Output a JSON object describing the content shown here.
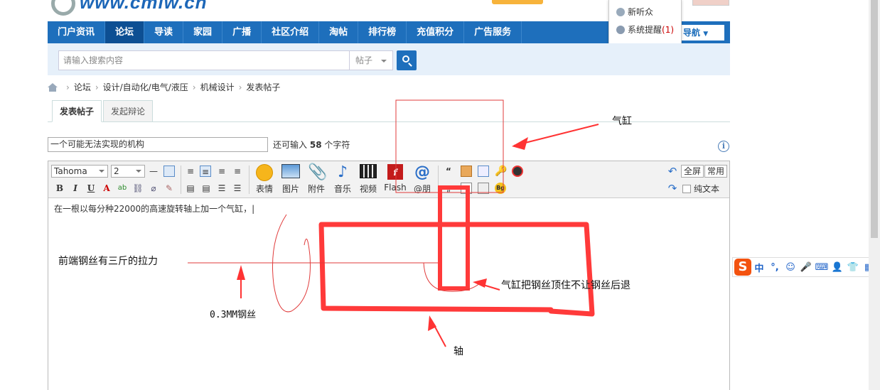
{
  "header": {
    "logo_text": "www.cmiw.cn"
  },
  "popup": {
    "items": [
      {
        "label": "新听众"
      },
      {
        "label": "系统提醒",
        "count": "(1)"
      }
    ]
  },
  "navbar": {
    "items": [
      "门户资讯",
      "论坛",
      "导读",
      "家园",
      "广播",
      "社区介绍",
      "淘帖",
      "排行榜",
      "充值积分",
      "广告服务"
    ],
    "active_index": 1,
    "right_label": "导航"
  },
  "search": {
    "placeholder": "请输入搜索内容",
    "type": "帖子"
  },
  "breadcrumb": {
    "items": [
      "论坛",
      "设计/自动化/电气/液压",
      "机械设计",
      "发表帖子"
    ]
  },
  "tabs": [
    {
      "label": "发表帖子",
      "active": true
    },
    {
      "label": "发起辩论",
      "active": false
    }
  ],
  "subject": {
    "value": "一个可能无法实现的机构",
    "hint_prefix": "还可输入",
    "remaining": "58",
    "hint_suffix": "个字符"
  },
  "editor": {
    "font": "Tahoma",
    "size": "2",
    "buttons": [
      "表情",
      "图片",
      "附件",
      "音乐",
      "视频",
      "Flash",
      "@朋"
    ],
    "fullscreen_label": "全屏",
    "common_label": "常用",
    "plain_text_label": "纯文本",
    "content": "在一根以每分种22000的高速旋转轴上加一个气缸，|"
  },
  "annotations": {
    "cylinder": "气缸",
    "wire_tension": "前端钢丝有三斤的拉力",
    "wire_size": "0.3MM钢丝",
    "cylinder_push": "气缸把钢丝顶住不让钢丝后退",
    "shaft": "轴"
  },
  "ime": {
    "items": [
      "中",
      "°,",
      "☺",
      "🎤",
      "⌨",
      "👤",
      "👕",
      "▦"
    ]
  },
  "colors": {
    "nav_blue": "#1e6fbc",
    "annotation_red": "#ff3333",
    "ime_orange": "#f3520f"
  }
}
